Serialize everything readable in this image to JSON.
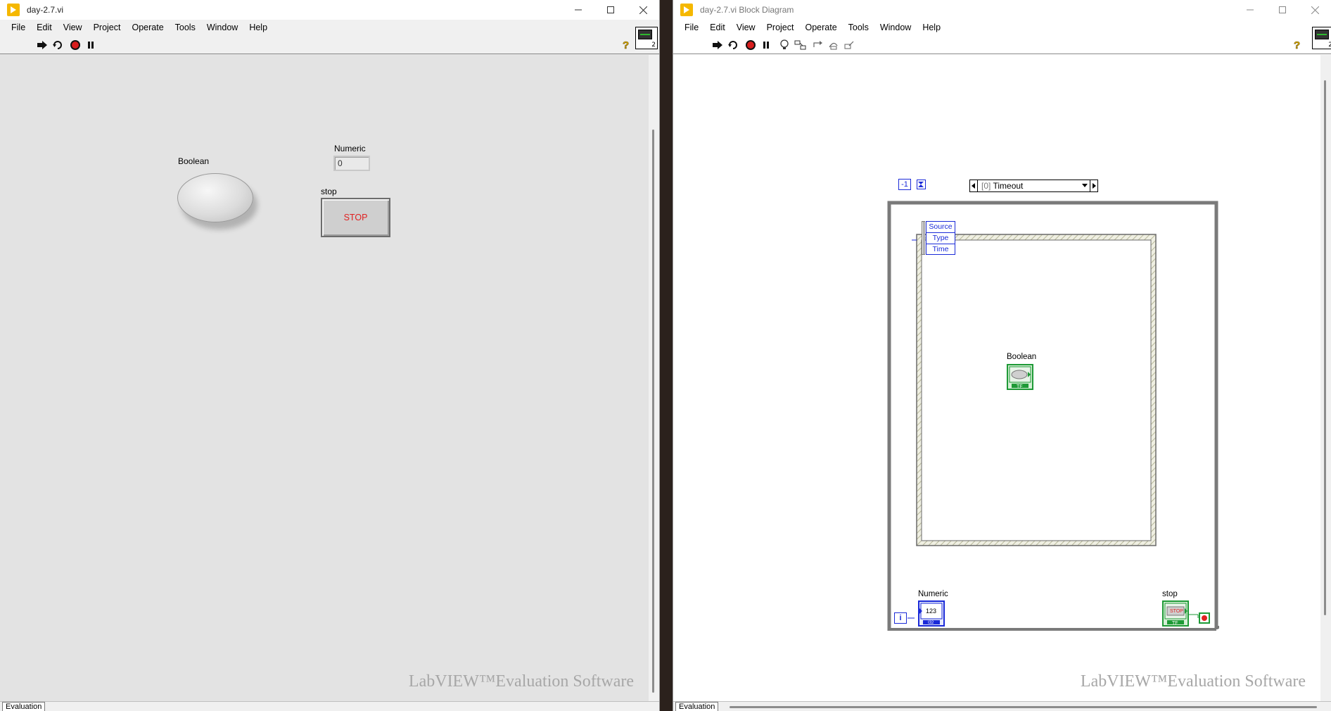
{
  "front_panel": {
    "title": "day-2.7.vi",
    "menu": [
      "File",
      "Edit",
      "View",
      "Project",
      "Operate",
      "Tools",
      "Window",
      "Help"
    ],
    "controls": {
      "boolean_label": "Boolean",
      "numeric_label": "Numeric",
      "numeric_value": "0",
      "stop_label": "stop",
      "stop_text": "STOP"
    },
    "vi_icon_number": "2",
    "watermark": "LabVIEW™Evaluation Software",
    "status_tab": "Evaluation"
  },
  "block_diagram": {
    "title": "day-2.7.vi Block Diagram",
    "menu": [
      "File",
      "Edit",
      "View",
      "Project",
      "Operate",
      "Tools",
      "Window",
      "Help"
    ],
    "timeout_constant": "-1",
    "event_case_index": "[0]",
    "event_case_name": "Timeout",
    "event_data_fields": [
      "Source",
      "Type",
      "Time"
    ],
    "boolean_label": "Boolean",
    "numeric_label": "Numeric",
    "numeric_term_text": "123",
    "stop_label": "stop",
    "stop_term_text": "STOP",
    "iteration_label": "i",
    "tf_text": "TF",
    "i32_text": "I32",
    "vi_icon_number": "2",
    "watermark": "LabVIEW™Evaluation Software",
    "status_tab": "Evaluation"
  },
  "colors": {
    "fp_background": "#e3e3e3",
    "bd_background": "#ffffff",
    "boolean_wire": "#1e9a36",
    "numeric_wire": "#1a2ad8",
    "stop_text": "#e02020",
    "title_icon": "#f5b800"
  }
}
